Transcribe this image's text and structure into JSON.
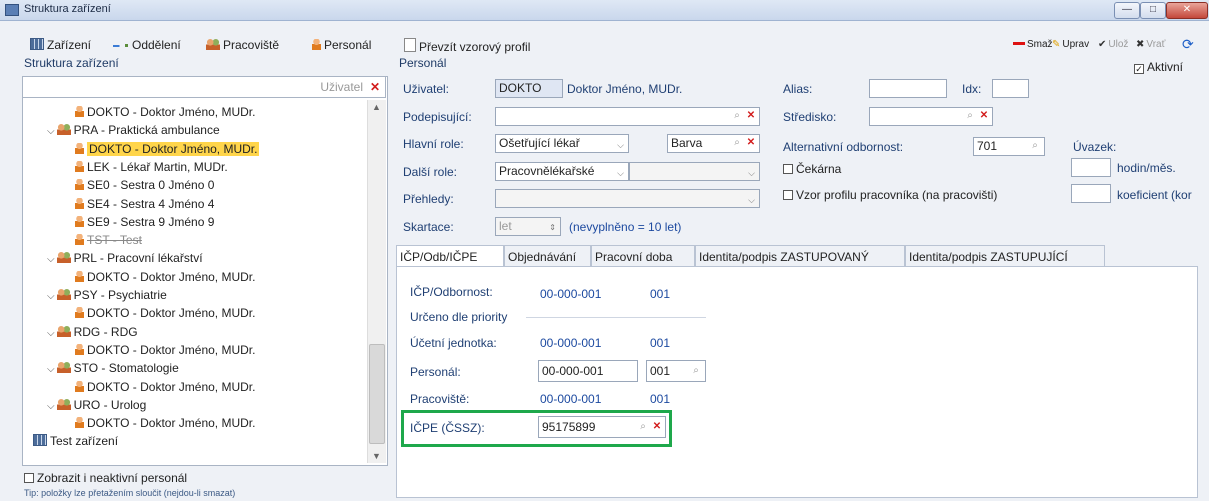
{
  "window": {
    "title": "Struktura zařízení",
    "min": "—",
    "max": "□",
    "close": "✕"
  },
  "left_toolbar": {
    "zarizeni": "Zařízení",
    "oddeleni": "Oddělení",
    "pracoviste": "Pracoviště",
    "personal": "Personál"
  },
  "structure_label": "Struktura zařízení",
  "search": {
    "placeholder": "Uživatel"
  },
  "tree": [
    {
      "level": 2,
      "kind": "person",
      "label": "DOKTO - Doktor Jméno, MUDr.",
      "selected": false
    },
    {
      "level": 1,
      "kind": "group",
      "label": "PRA - Praktická ambulance",
      "selected": false
    },
    {
      "level": 2,
      "kind": "person",
      "label": "DOKTO - Doktor Jméno, MUDr.",
      "selected": true
    },
    {
      "level": 2,
      "kind": "person",
      "label": "LEK - Lékař Martin, MUDr.",
      "selected": false
    },
    {
      "level": 2,
      "kind": "person",
      "label": "SE0 - Sestra 0 Jméno 0",
      "selected": false
    },
    {
      "level": 2,
      "kind": "person",
      "label": "SE4 - Sestra 4 Jméno 4",
      "selected": false
    },
    {
      "level": 2,
      "kind": "person",
      "label": "SE9 - Sestra 9 Jméno 9",
      "selected": false
    },
    {
      "level": 2,
      "kind": "person",
      "label": "TST - Test",
      "selected": false,
      "struck": true
    },
    {
      "level": 1,
      "kind": "group",
      "label": "PRL - Pracovní lékařství",
      "selected": false
    },
    {
      "level": 2,
      "kind": "person",
      "label": "DOKTO - Doktor Jméno, MUDr.",
      "selected": false
    },
    {
      "level": 1,
      "kind": "group",
      "label": "PSY - Psychiatrie",
      "selected": false
    },
    {
      "level": 2,
      "kind": "person",
      "label": "DOKTO - Doktor Jméno, MUDr.",
      "selected": false
    },
    {
      "level": 1,
      "kind": "group",
      "label": "RDG - RDG",
      "selected": false
    },
    {
      "level": 2,
      "kind": "person",
      "label": "DOKTO - Doktor Jméno, MUDr.",
      "selected": false
    },
    {
      "level": 1,
      "kind": "group",
      "label": "STO - Stomatologie",
      "selected": false
    },
    {
      "level": 2,
      "kind": "person",
      "label": "DOKTO - Doktor Jméno, MUDr.",
      "selected": false
    },
    {
      "level": 1,
      "kind": "group",
      "label": "URO - Urolog",
      "selected": false
    },
    {
      "level": 2,
      "kind": "person",
      "label": "DOKTO - Doktor Jméno, MUDr.",
      "selected": false
    },
    {
      "level": 0,
      "kind": "facility",
      "label": "Test zařízení",
      "selected": false
    }
  ],
  "show_inactive": "Zobrazit i neaktivní personál",
  "tip": "Tip: položky lze přetažením sloučit (nejdou-li smazat)",
  "right_toolbar": {
    "prevzit": "Převzít vzorový profil",
    "smaz": "Smaž",
    "uprav": "Uprav",
    "uloz": "Ulož",
    "vrat": "Vrať"
  },
  "personal": {
    "section": "Personál",
    "uzivatel_label": "Uživatel:",
    "uzivatel_code": "DOKTO",
    "uzivatel_name": "Doktor Jméno, MUDr.",
    "podepisujici_label": "Podepisující:",
    "hlavni_role_label": "Hlavní role:",
    "hlavni_role_value": "Ošetřující lékař",
    "barva_label": "Barva",
    "dalsi_role_label": "Další role:",
    "dalsi_role_value": "Pracovnělékařské",
    "prehledy_label": "Přehledy:",
    "skartace_label": "Skartace:",
    "skartace_value": "let",
    "skartace_note": "(nevyplněno = 10 let)",
    "alias_label": "Alias:",
    "idx_label": "Idx:",
    "stredisko_label": "Středisko:",
    "alt_odb_label": "Alternativní odbornost:",
    "alt_odb_value": "701",
    "uvazek_label": "Úvazek:",
    "hodin_label": "hodin/měs.",
    "koef_label": "koeficient (kor",
    "cekarna_label": "Čekárna",
    "vzor_label": "Vzor profilu pracovníka (na pracovišti)",
    "aktivni_label": "Aktivní"
  },
  "tabs": [
    {
      "label": "IČP/Odb/IČPE",
      "active": true
    },
    {
      "label": "Objednávání",
      "active": false
    },
    {
      "label": "Pracovní doba",
      "active": false
    },
    {
      "label": "Identita/podpis ZASTUPOVANÝ",
      "active": false
    },
    {
      "label": "Identita/podpis ZASTUPUJÍCÍ",
      "active": false
    }
  ],
  "tab_content": {
    "icp_odb_label": "IČP/Odbornost:",
    "icp_odb_icp": "00-000-001",
    "icp_odb_odb": "001",
    "urceno_label": "Určeno dle priority",
    "ucetni_label": "Účetní jednotka:",
    "ucetni_icp": "00-000-001",
    "ucetni_odb": "001",
    "personal_label": "Personál:",
    "personal_icp": "00-000-001",
    "personal_odb": "001",
    "pracoviste_label": "Pracoviště:",
    "pracoviste_icp": "00-000-001",
    "pracoviste_odb": "001",
    "icpe_label": "IČPE (ČSSZ):",
    "icpe_value": "95175899"
  },
  "colors": {
    "highlight": "#ffd54a",
    "green_box": "#1ea84b",
    "label_blue": "#1f3f73"
  }
}
